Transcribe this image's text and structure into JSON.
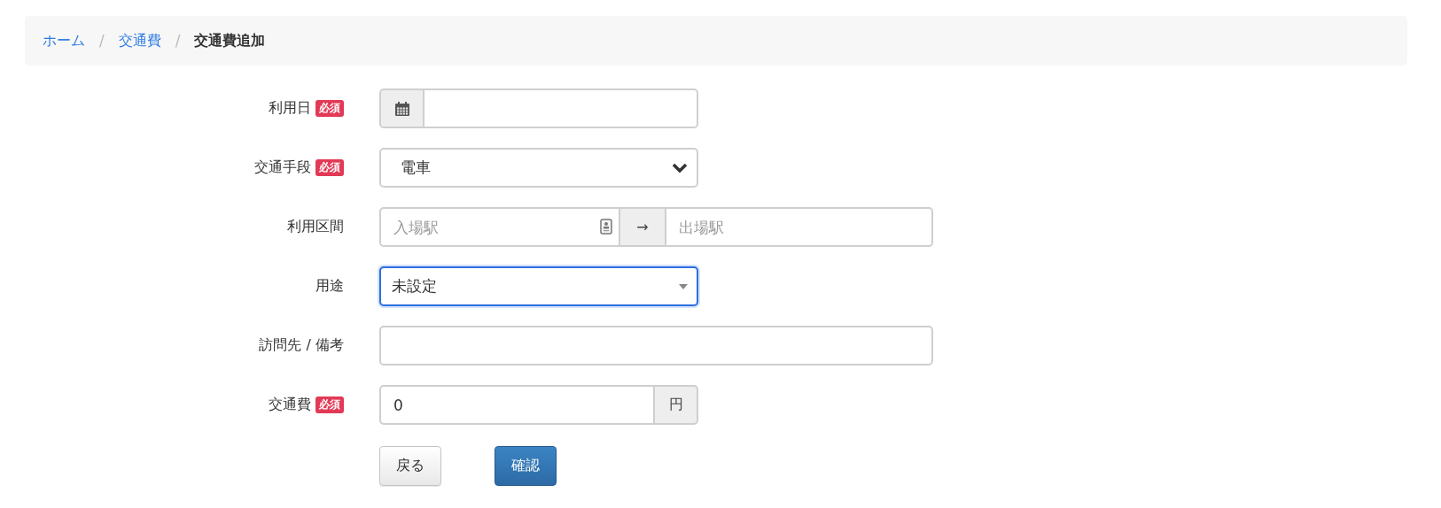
{
  "breadcrumb": [
    {
      "label": "ホーム",
      "kind": "link"
    },
    {
      "label": "交通費",
      "kind": "link"
    },
    {
      "label": "交通費追加",
      "kind": "current"
    }
  ],
  "breadcrumb_separator": "/",
  "fields": [
    {
      "kind": "date",
      "label": "利用日",
      "badge": "必須"
    },
    {
      "kind": "select",
      "label": "交通手段",
      "badge": "必須",
      "value": "電車"
    },
    {
      "kind": "route",
      "label": "利用区間",
      "from_placeholder": "入場駅",
      "arrow": "→",
      "to_placeholder": "出場駅"
    },
    {
      "kind": "dropdown",
      "label": "用途",
      "value": "未設定",
      "focused": true
    },
    {
      "kind": "text",
      "label": "訪問先 / 備考"
    },
    {
      "kind": "amount",
      "label": "交通費",
      "badge": "必須",
      "value": "0",
      "unit": "円"
    }
  ],
  "buttons": [
    {
      "label": "戻る",
      "kind": "default"
    },
    {
      "label": "確認",
      "kind": "primary"
    }
  ]
}
